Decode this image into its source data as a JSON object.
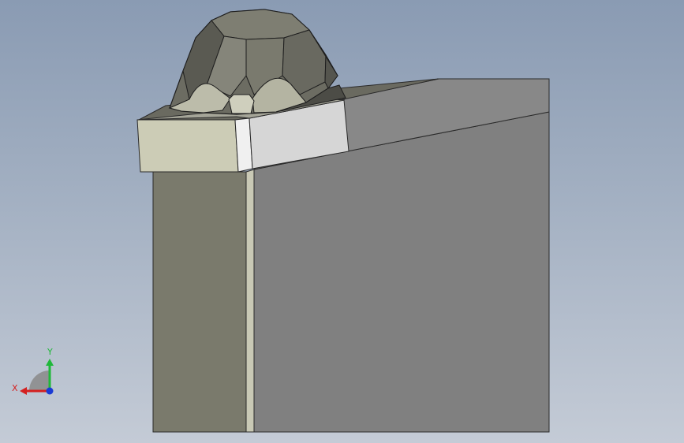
{
  "view": {
    "type": "3d-cad-viewport",
    "background_colors": {
      "top": "#8a9bb3",
      "bottom": "#c4cbd6"
    }
  },
  "model": {
    "colors": {
      "block_face": "#808080",
      "block_side": "#7a7a6c",
      "insert_front": "#ccccb6",
      "insert_side": "#d6d6d6",
      "cap_dark": "#5a5a52",
      "cap_mid": "#77776b",
      "cap_light": "#bcbcaa"
    }
  },
  "triad": {
    "x_label": "X",
    "y_label": "Y",
    "colors": {
      "x": "#d42020",
      "y": "#1fb83a",
      "z": "#1a3ad4"
    }
  }
}
